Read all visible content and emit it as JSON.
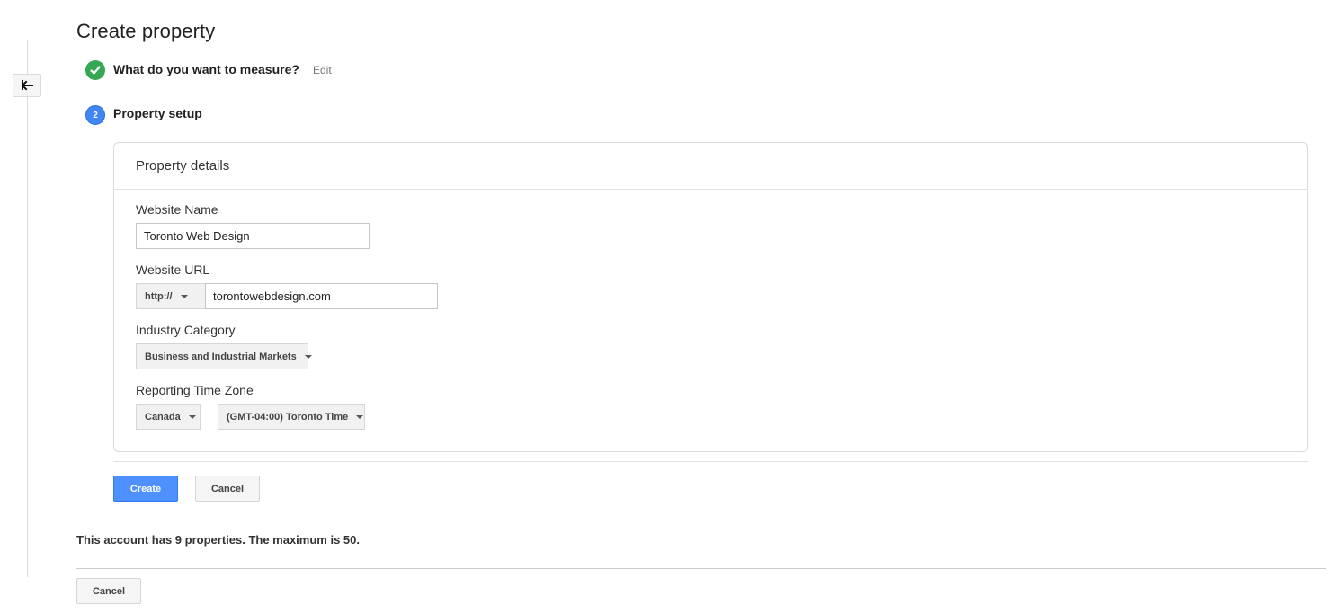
{
  "page": {
    "title": "Create property"
  },
  "steps": [
    {
      "number": "",
      "label": "What do you want to measure?",
      "action": "Edit",
      "status": "complete"
    },
    {
      "number": "2",
      "label": "Property setup",
      "status": "active"
    }
  ],
  "property_details": {
    "title": "Property details",
    "website_name": {
      "label": "Website Name",
      "value": "Toronto Web Design"
    },
    "website_url": {
      "label": "Website URL",
      "protocol": "http://",
      "value": "torontowebdesign.com"
    },
    "industry_category": {
      "label": "Industry Category",
      "value": "Business and Industrial Markets"
    },
    "reporting_time_zone": {
      "label": "Reporting Time Zone",
      "country": "Canada",
      "zone": "(GMT-04:00) Toronto Time"
    }
  },
  "actions": {
    "create_label": "Create",
    "cancel_label": "Cancel"
  },
  "footer": {
    "quota_text": "This account has 9 properties. The maximum is 50.",
    "cancel_label": "Cancel"
  },
  "colors": {
    "complete_green": "#34a853",
    "active_blue": "#4285f4",
    "primary_button": "#4d90fe"
  },
  "icons": {
    "back": "back-arrow-icon",
    "step_complete": "checkmark-icon",
    "dropdown": "caret-down-icon"
  }
}
